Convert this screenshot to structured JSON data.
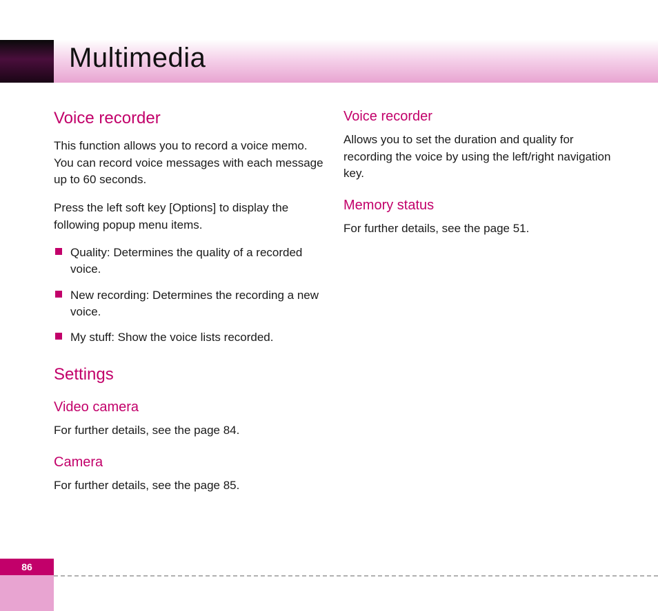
{
  "header": {
    "title": "Multimedia"
  },
  "left_column": {
    "voice_recorder": {
      "heading": "Voice recorder",
      "para1": "This function allows you to record a voice memo. You can record voice messages with each message up to 60 seconds.",
      "para2": "Press the left soft key [Options] to display the following popup menu items.",
      "bullets": [
        "Quality: Determines the quality of a recorded voice.",
        "New recording: Determines the recording a new voice.",
        "My stuff: Show the voice lists recorded."
      ]
    },
    "settings": {
      "heading": "Settings",
      "video_camera": {
        "heading": "Video camera",
        "para": "For further details, see the page 84."
      },
      "camera": {
        "heading": "Camera",
        "para": "For further details, see the page 85."
      }
    }
  },
  "right_column": {
    "voice_recorder": {
      "heading": "Voice recorder",
      "para": "Allows you to set the duration and quality for recording the voice by using the left/right navigation key."
    },
    "memory_status": {
      "heading": "Memory status",
      "para": "For further details, see the page 51."
    }
  },
  "page_number": "86"
}
